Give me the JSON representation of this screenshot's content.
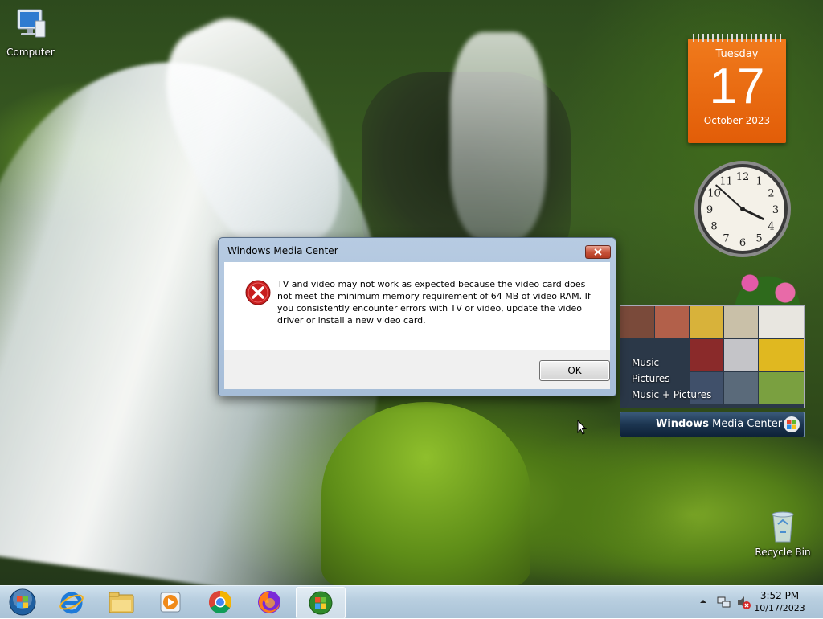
{
  "desktop": {
    "icons": {
      "computer": "Computer",
      "recycle_bin": "Recycle Bin"
    }
  },
  "calendar_gadget": {
    "weekday": "Tuesday",
    "day": "17",
    "month_year": "October 2023"
  },
  "clock_gadget": {
    "numbers": [
      "12",
      "1",
      "2",
      "3",
      "4",
      "5",
      "6",
      "7",
      "8",
      "9",
      "10",
      "11"
    ],
    "time": "3:52"
  },
  "media_center_gadget": {
    "menu": [
      "Music",
      "Pictures",
      "Music + Pictures"
    ],
    "bar_label_bold": "Windows",
    "bar_label_rest": " Media Center"
  },
  "dialog": {
    "title": "Windows Media Center",
    "message": "TV and video may not work as expected because the video card does not meet the minimum memory requirement of 64 MB of video RAM. If you consistently encounter errors with TV or video, update the video driver or install a new video card.",
    "ok_label": "OK"
  },
  "taskbar": {
    "pinned": [
      "start-orb-icon",
      "internet-explorer-icon",
      "file-explorer-icon",
      "media-player-icon",
      "chrome-icon",
      "firefox-icon",
      "windows-media-center-icon"
    ],
    "time": "3:52 PM",
    "date": "10/17/2023"
  },
  "colors": {
    "calendar_orange": "#e86a10",
    "taskbar": "#b9cfe0",
    "dialog_frame": "#a6bdd8",
    "error_red": "#c81e1e"
  }
}
